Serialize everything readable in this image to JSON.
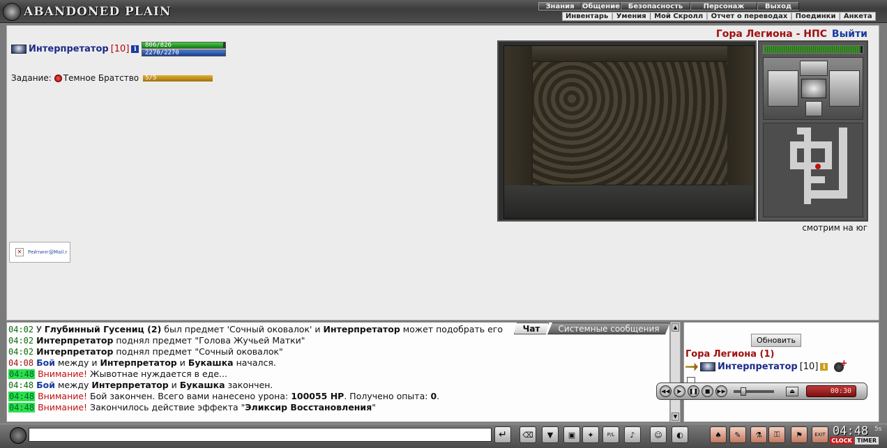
{
  "header": {
    "logo_text": "ABANDONED PLAIN",
    "menu_primary": [
      {
        "label": "Знания"
      },
      {
        "label": "Общение"
      },
      {
        "label": "Безопасность"
      },
      {
        "label": "Персонаж"
      },
      {
        "label": "Выход"
      }
    ],
    "menu_secondary": [
      {
        "label": "Инвентарь"
      },
      {
        "label": "Умения"
      },
      {
        "label": "Мой Скролл"
      },
      {
        "label": "Отчет о переводах"
      },
      {
        "label": "Поединки"
      },
      {
        "label": "Анкета"
      }
    ]
  },
  "player": {
    "name": "Интерпретатор",
    "level": "[10]",
    "info_icon": "info-icon",
    "hp_text": "806/826",
    "hp_fraction": 0.976,
    "mp_text": "2270/2270",
    "mp_fraction": 1.0
  },
  "quest": {
    "label": "Задание:",
    "name": "Темное Братство",
    "progress_text": "5/5",
    "progress_fraction": 1.0
  },
  "location": {
    "title": "Гора Легиона - НПС",
    "exit_label": "Выйти",
    "facing": "смотрим на юг",
    "hp_fraction": 0.98
  },
  "rating_badge": {
    "text": "Рейтинг@Mail.r"
  },
  "chat": {
    "tabs": [
      {
        "label": "Чат",
        "active": true
      },
      {
        "label": "Системные сообщения",
        "active": false
      }
    ],
    "lines": [
      {
        "time": "04:02",
        "parts": [
          {
            "text": "У "
          },
          {
            "text": "Глубинный Гусениц (2)",
            "bold": true
          },
          {
            "text": " был предмет 'Сочный оковалок' и "
          },
          {
            "text": "Интерпретатор",
            "bold": true
          },
          {
            "text": " может подобрать его"
          }
        ]
      },
      {
        "time": "04:02",
        "parts": [
          {
            "text": "Интерпретатор",
            "bold": true
          },
          {
            "text": " поднял предмет \"Голова Жучьей Матки\""
          }
        ]
      },
      {
        "time": "04:02",
        "parts": [
          {
            "text": "Интерпретатор",
            "bold": true
          },
          {
            "text": " поднял предмет \"Сочный оковалок\""
          }
        ]
      },
      {
        "time": "04:08",
        "time_style": "red",
        "parts": [
          {
            "text": "Бой",
            "battle": true
          },
          {
            "text": " между и "
          },
          {
            "text": "Интерпретатор",
            "bold": true
          },
          {
            "text": " и "
          },
          {
            "text": "Букашка",
            "bold": true
          },
          {
            "text": " начался."
          }
        ]
      },
      {
        "time": "04:48",
        "time_style": "hl",
        "parts": [
          {
            "text": "Внимание!",
            "warn": true
          },
          {
            "text": " Жывотнае нуждается в еде..."
          }
        ]
      },
      {
        "time": "04:48",
        "parts": [
          {
            "text": "Бой",
            "battle": true
          },
          {
            "text": " между "
          },
          {
            "text": "Интерпретатор",
            "bold": true
          },
          {
            "text": " и "
          },
          {
            "text": "Букашка",
            "bold": true
          },
          {
            "text": " закончен."
          }
        ]
      },
      {
        "time": "04:48",
        "time_style": "hl",
        "parts": [
          {
            "text": "Внимание!",
            "warn": true
          },
          {
            "text": " Бой закончен. Всего вами нанесено урона: "
          },
          {
            "text": "100055 HP",
            "bold": true
          },
          {
            "text": ". Получено опыта: "
          },
          {
            "text": "0",
            "bold": true
          },
          {
            "text": "."
          }
        ]
      },
      {
        "time": "04:48",
        "time_style": "hl",
        "parts": [
          {
            "text": "Внимание!",
            "warn": true
          },
          {
            "text": " Закончилось действие эффекта \""
          },
          {
            "text": "Эликсир Восстановления",
            "bold": true
          },
          {
            "text": "\""
          }
        ]
      }
    ],
    "input_value": ""
  },
  "room_panel": {
    "refresh_label": "Обновить",
    "location_count": "Гора Легиона (1)",
    "occupant_name": "Интерпретатор",
    "occupant_level": "[10]"
  },
  "media_player": {
    "buttons": [
      "prev-icon",
      "play-icon",
      "pause-icon",
      "stop-icon",
      "next-icon"
    ],
    "volume_fraction": 0.2,
    "time": "00:30"
  },
  "toolbar": {
    "send_label": "↵",
    "tools": [
      {
        "name": "eraser-tool-icon",
        "glyph": "⌫"
      },
      {
        "name": "filter-tool-icon",
        "glyph": "▼"
      },
      {
        "name": "save-tool-icon",
        "glyph": "▣"
      },
      {
        "name": "walk-tool-icon",
        "glyph": "✦"
      },
      {
        "name": "pl-tool-icon",
        "glyph": "P/L"
      },
      {
        "name": "music-tool-icon",
        "glyph": "♪"
      },
      {
        "name": "smile-tool-icon",
        "glyph": "☺"
      },
      {
        "name": "helmet-tool-icon",
        "glyph": "◐"
      },
      {
        "name": "bag-tool-icon",
        "glyph": "♠"
      },
      {
        "name": "scroll-tool-icon",
        "glyph": "✎"
      },
      {
        "name": "potion-tool-icon",
        "glyph": "⚗"
      },
      {
        "name": "lock-tool-icon",
        "glyph": "⚿"
      },
      {
        "name": "flag-tool-icon",
        "glyph": "⚑"
      },
      {
        "name": "exit-tool-icon",
        "glyph": "EXIT"
      }
    ],
    "clock_time": "04:48",
    "clock_seconds": "5s",
    "clock_label": "CLOCK",
    "timer_label": "TIMER"
  }
}
